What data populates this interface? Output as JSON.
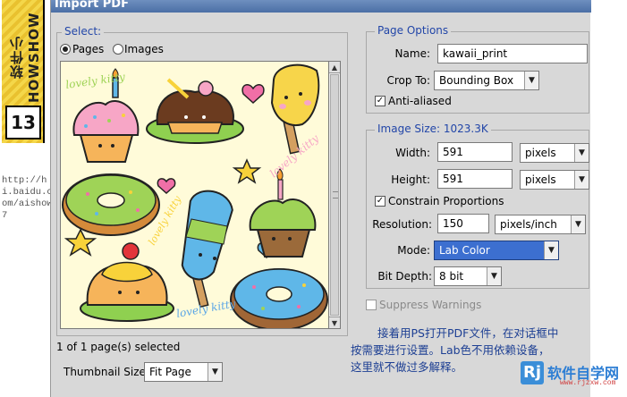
{
  "tutorial": {
    "series": "软件小HOWSHOW",
    "number": "13",
    "source_url": "http://hi.baidu.com/aishow7"
  },
  "dialog": {
    "title": "Import PDF",
    "select_group": {
      "title": "Select:",
      "options": [
        "Pages",
        "Images"
      ],
      "selected": "Pages",
      "status": "1 of 1 page(s) selected",
      "thumbnail_size_label": "Thumbnail Size:",
      "thumbnail_size_value": "Fit Page"
    },
    "page_options": {
      "title": "Page Options",
      "name_label": "Name:",
      "name_value": "kawaii_print",
      "crop_label": "Crop To:",
      "crop_value": "Bounding Box",
      "anti_aliased_label": "Anti-aliased",
      "anti_aliased": true
    },
    "image_size": {
      "title": "Image Size: 1023.3K",
      "width_label": "Width:",
      "width_value": "591",
      "width_unit": "pixels",
      "height_label": "Height:",
      "height_value": "591",
      "height_unit": "pixels",
      "constrain_label": "Constrain Proportions",
      "constrain": true,
      "resolution_label": "Resolution:",
      "resolution_value": "150",
      "resolution_unit": "pixels/inch",
      "mode_label": "Mode:",
      "mode_value": "Lab Color",
      "bit_depth_label": "Bit Depth:",
      "bit_depth_value": "8 bit"
    },
    "suppress_warnings_label": "Suppress Warnings",
    "suppress_warnings": false
  },
  "annotation": {
    "lines": [
      "接着用PS打开PDF文件，在对话框中",
      "按需要进行设置。Lab色不用依赖设备，",
      "这里就不做过多解释。"
    ]
  },
  "watermark": {
    "logo_letter": "Rj",
    "text": "软件自学网",
    "url": "www.rjzxw.com"
  },
  "preview": {
    "labels": [
      "lovely kitty",
      "lovely kitty",
      "lovely kitty",
      "lovely kitty"
    ],
    "colors": {
      "cream": "#fffbd9",
      "frosting_pink": "#f7a6c6",
      "frosting_green": "#9fd357",
      "chocolate": "#6b3b1f",
      "cake": "#f6b45a",
      "popsicle_blue": "#5fb7e8",
      "popsicle_yellow": "#f7d54a",
      "heart_pink": "#f06fa7",
      "star_yellow": "#f8d23a",
      "plate_green": "#8fd050",
      "label_blue": "#5ba6e6"
    }
  }
}
